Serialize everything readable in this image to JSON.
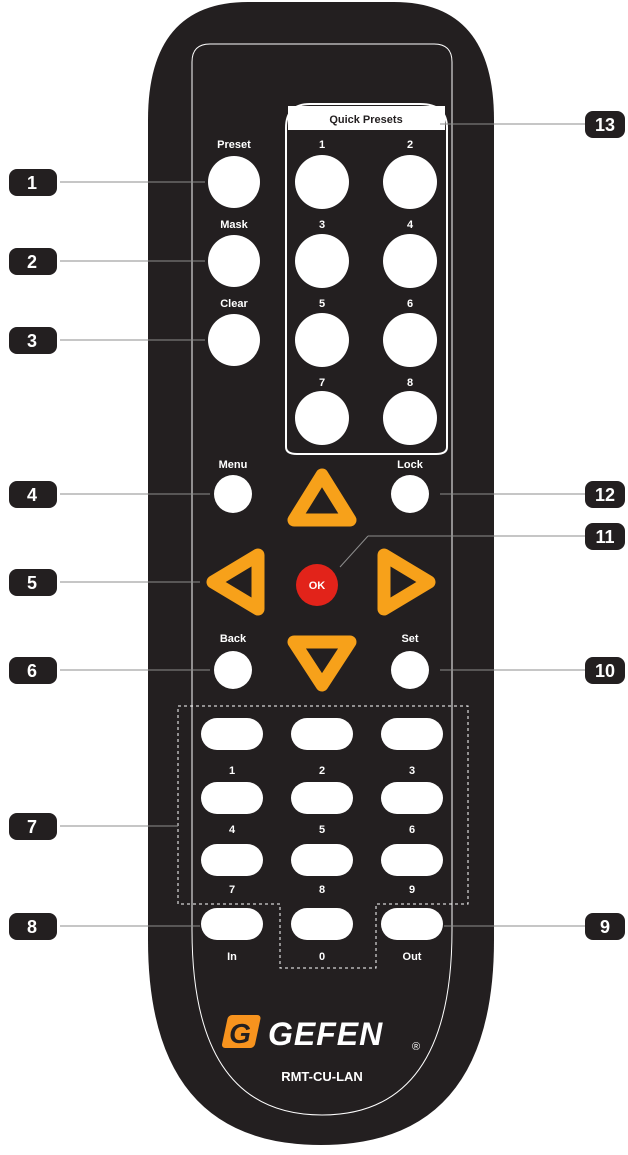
{
  "remote": {
    "model": "RMT-CU-LAN",
    "brand": "GEFEN",
    "registered_mark": "®",
    "quick_presets_title": "Quick Presets",
    "left_buttons": {
      "preset": "Preset",
      "mask": "Mask",
      "clear": "Clear"
    },
    "quick_presets": [
      "1",
      "2",
      "3",
      "4",
      "5",
      "6",
      "7",
      "8"
    ],
    "nav": {
      "menu": "Menu",
      "lock": "Lock",
      "ok": "OK",
      "back": "Back",
      "set": "Set"
    },
    "keypad": [
      "1",
      "2",
      "3",
      "4",
      "5",
      "6",
      "7",
      "8",
      "9"
    ],
    "zero": "0",
    "in": "In",
    "out": "Out"
  },
  "callouts": {
    "left": [
      "1",
      "2",
      "3",
      "4",
      "5",
      "6",
      "7",
      "8"
    ],
    "right": [
      "13",
      "12",
      "11",
      "10",
      "9"
    ]
  },
  "colors": {
    "body": "#231f20",
    "button": "#ffffff",
    "arrow": "#f7a11a",
    "ok": "#e2231a",
    "logo_accent": "#f7931e",
    "callout_bg": "#231f20",
    "leader_line": "#8c8c8c"
  }
}
